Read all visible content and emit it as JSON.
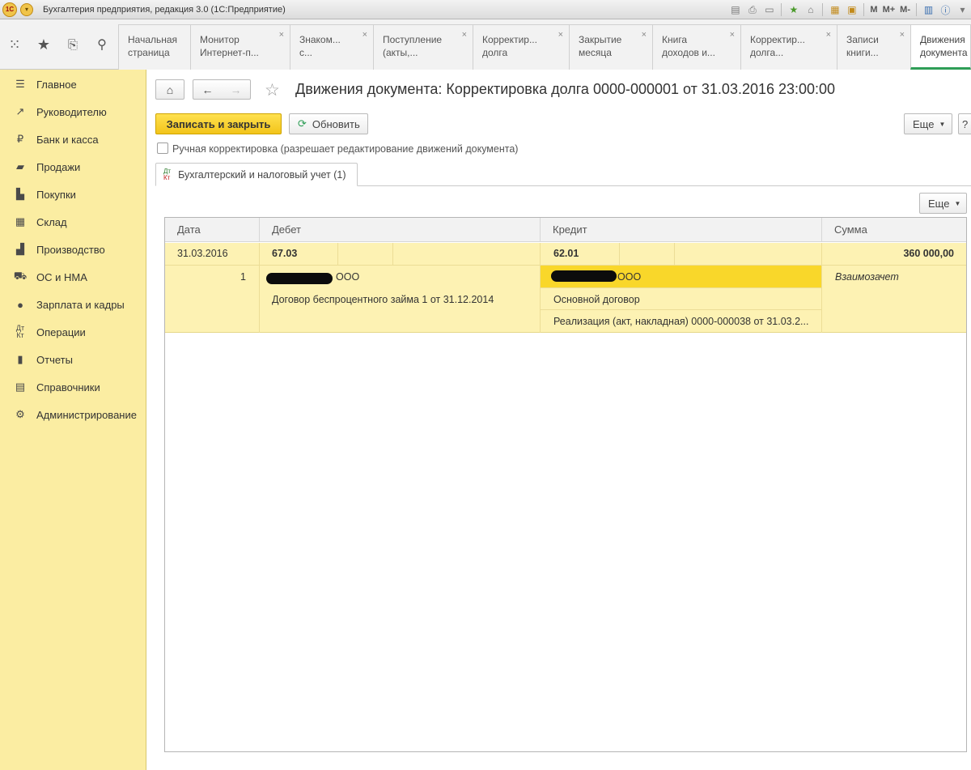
{
  "window": {
    "title": "Бухгалтерия предприятия, редакция 3.0  (1С:Предприятие)",
    "tools": [
      "M",
      "M+",
      "M-"
    ]
  },
  "tabs": [
    {
      "line1": "Начальная",
      "line2": "страница",
      "closable": false
    },
    {
      "line1": "Монитор",
      "line2": "Интернет-п...",
      "closable": true
    },
    {
      "line1": "Знаком...",
      "line2": "с...",
      "closable": true
    },
    {
      "line1": "Поступление",
      "line2": "(акты,...",
      "closable": true
    },
    {
      "line1": "Корректир...",
      "line2": "долга",
      "closable": true
    },
    {
      "line1": "Закрытие",
      "line2": "месяца",
      "closable": true
    },
    {
      "line1": "Книга",
      "line2": "доходов и...",
      "closable": true
    },
    {
      "line1": "Корректир...",
      "line2": "долга...",
      "closable": true
    },
    {
      "line1": "Записи",
      "line2": "книги...",
      "closable": true
    },
    {
      "line1": "Движения",
      "line2": "документа",
      "closable": false
    }
  ],
  "sidebar": {
    "items": [
      {
        "label": "Главное",
        "icon": "menu-lines-icon"
      },
      {
        "label": "Руководителю",
        "icon": "trend-up-icon"
      },
      {
        "label": "Банк и касса",
        "icon": "ruble-coin-icon"
      },
      {
        "label": "Продажи",
        "icon": "shopping-bag-icon"
      },
      {
        "label": "Покупки",
        "icon": "cart-icon"
      },
      {
        "label": "Склад",
        "icon": "warehouse-grid-icon"
      },
      {
        "label": "Производство",
        "icon": "factory-icon"
      },
      {
        "label": "ОС и НМА",
        "icon": "truck-icon"
      },
      {
        "label": "Зарплата и кадры",
        "icon": "person-icon"
      },
      {
        "label": "Операции",
        "icon": "dt-kt-icon"
      },
      {
        "label": "Отчеты",
        "icon": "bar-chart-icon"
      },
      {
        "label": "Справочники",
        "icon": "book-icon"
      },
      {
        "label": "Администрирование",
        "icon": "gear-icon"
      }
    ]
  },
  "page": {
    "title": "Движения документа: Корректировка долга 0000-000001 от 31.03.2016 23:00:00",
    "save_close_label": "Записать и закрыть",
    "refresh_label": "Обновить",
    "more_label": "Еще",
    "help_label": "?",
    "manual_correction_label": "Ручная корректировка (разрешает редактирование движений документа)",
    "manual_correction_checked": false,
    "subtab_label": "Бухгалтерский и налоговый учет (1)",
    "subtab_icon_top": "Дт",
    "subtab_icon_bottom": "Кт",
    "grid_more_label": "Еще"
  },
  "grid": {
    "columns": [
      "Дата",
      "Дебет",
      "Кредит",
      "Сумма"
    ],
    "row": {
      "date": "31.03.2016",
      "line_number": "1",
      "debit_account": "67.03",
      "debit_subconto1_suffix": "ООО",
      "debit_subconto2": "Договор беспроцентного займа 1 от 31.12.2014",
      "credit_account": "62.01",
      "credit_subconto1_suffix": "ООО",
      "credit_subconto2": "Основной договор",
      "credit_subconto3": "Реализация (акт, накладная) 0000-000038 от 31.03.2...",
      "amount": "360 000,00",
      "content": "Взаимозачет"
    }
  }
}
